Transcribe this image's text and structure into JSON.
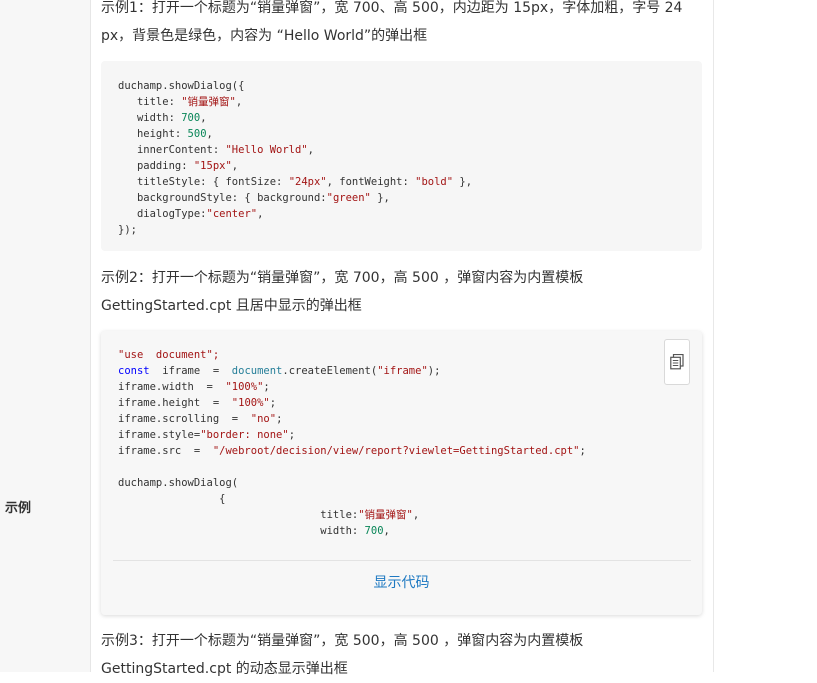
{
  "row_label": "示例",
  "example1": {
    "text": "示例1：打开一个标题为“销量弹窗”，宽 700、高 500，内边距为 15px，字体加粗，字号 24 px，背景色是绿色，内容为 “Hello World”的弹出框",
    "code": [
      "duchamp.showDialog({",
      "   title: \"销量弹窗\",",
      "   width: 700,",
      "   height: 500,",
      "   innerContent: \"Hello World\",",
      "   padding: \"15px\",",
      "   titleStyle: { fontSize: \"24px\", fontWeight: \"bold\" },",
      "   backgroundStyle: { background:\"green\" },",
      "   dialogType:\"center\",",
      "});"
    ]
  },
  "example2": {
    "text": "示例2：打开一个标题为“销量弹窗”，宽 700，高 500 ，弹窗内容为内置模板 GettingStarted.cpt 且居中显示的弹出框",
    "code": [
      "\"use  document\";",
      "const  iframe  =  document.createElement(\"iframe\");",
      "iframe.width  =  \"100%\";",
      "iframe.height  =  \"100%\";",
      "iframe.scrolling  =  \"no\";",
      "iframe.style=\"border: none\";",
      "iframe.src  =  \"/webroot/decision/view/report?viewlet=GettingStarted.cpt\";",
      "",
      "duchamp.showDialog(",
      "                {",
      "                                title:\"销量弹窗\",",
      "                                width: 700,"
    ],
    "show_code_label": "显示代码"
  },
  "example3": {
    "text": "示例3：打开一个标题为“销量弹窗”，宽 500，高 500 ，弹窗内容为内置模板 GettingStarted.cpt 的动态显示弹出框"
  },
  "icons": {
    "copy": "copy-icon"
  }
}
